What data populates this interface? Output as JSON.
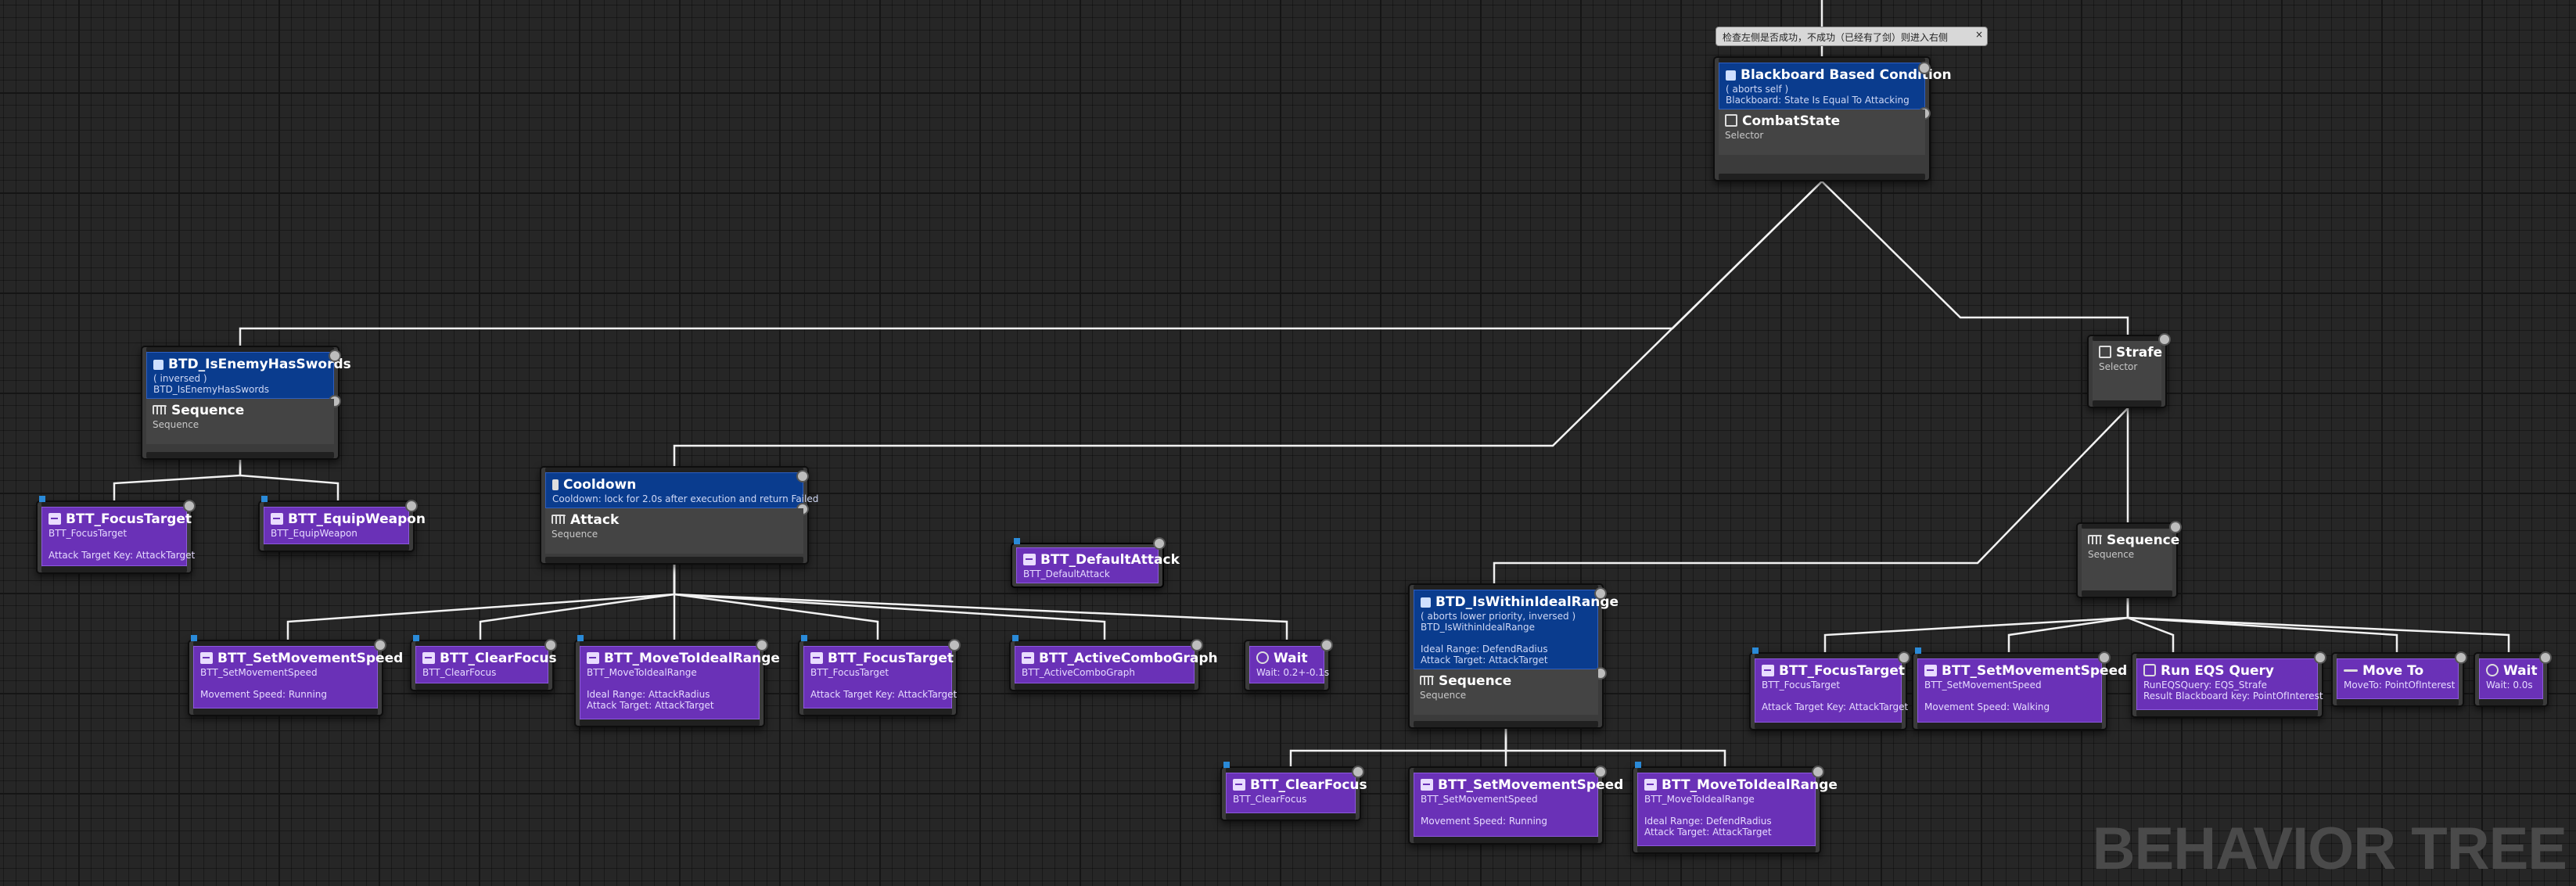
{
  "graph_label": "BEHAVIOR TREE",
  "comment": {
    "text": "检查左侧是否成功，不成功（已经有了剑）则进入右侧",
    "close_glyph": "×"
  },
  "nodes": {
    "root": {
      "decorator": {
        "title": "Blackboard Based Condition",
        "lines": [
          "( aborts self )",
          "Blackboard: State Is Equal To Attacking"
        ]
      },
      "title": "CombatState",
      "type": "Selector"
    },
    "enemy_swords": {
      "decorator": {
        "title": "BTD_IsEnemyHasSwords",
        "lines": [
          "( inversed )",
          "BTD_IsEnemyHasSwords"
        ]
      },
      "title": "Sequence",
      "type": "Sequence"
    },
    "t_focus_1": {
      "title": "BTT_FocusTarget",
      "lines": [
        "BTT_FocusTarget",
        "",
        "Attack Target Key: AttackTarget"
      ]
    },
    "t_equip": {
      "title": "BTT_EquipWeapon",
      "lines": [
        "BTT_EquipWeapon"
      ]
    },
    "attack": {
      "decorator": {
        "title": "Cooldown",
        "lines": [
          "Cooldown: lock for 2.0s after execution and return Failed"
        ]
      },
      "title": "Attack",
      "type": "Sequence"
    },
    "t_default_attack": {
      "title": "BTT_DefaultAttack",
      "lines": [
        "BTT_DefaultAttack"
      ]
    },
    "t_setspeed_1": {
      "title": "BTT_SetMovementSpeed",
      "lines": [
        "BTT_SetMovementSpeed",
        "",
        "Movement Speed: Running"
      ]
    },
    "t_clearfocus_1": {
      "title": "BTT_ClearFocus",
      "lines": [
        "BTT_ClearFocus"
      ]
    },
    "t_moveideal_1": {
      "title": "BTT_MoveToIdealRange",
      "lines": [
        "BTT_MoveToIdealRange",
        "",
        "Ideal Range: AttackRadius",
        "Attack Target: AttackTarget"
      ]
    },
    "t_focus_2": {
      "title": "BTT_FocusTarget",
      "lines": [
        "BTT_FocusTarget",
        "",
        "Attack Target Key: AttackTarget"
      ]
    },
    "t_combo": {
      "title": "BTT_ActiveComboGraph",
      "lines": [
        "BTT_ActiveComboGraph"
      ]
    },
    "t_wait_1": {
      "title": "Wait",
      "lines": [
        "Wait: 0.2+-0.1s"
      ]
    },
    "ideal_range": {
      "decorator": {
        "title": "BTD_IsWithinIdealRange",
        "lines": [
          "( aborts lower priority, inversed )",
          "BTD_IsWithinIdealRange",
          "",
          "Ideal Range: DefendRadius",
          "Attack Target: AttackTarget"
        ]
      },
      "title": "Sequence",
      "type": "Sequence"
    },
    "t_clearfocus_2": {
      "title": "BTT_ClearFocus",
      "lines": [
        "BTT_ClearFocus"
      ]
    },
    "t_setspeed_2": {
      "title": "BTT_SetMovementSpeed",
      "lines": [
        "BTT_SetMovementSpeed",
        "",
        "Movement Speed: Running"
      ]
    },
    "t_moveideal_2": {
      "title": "BTT_MoveToIdealRange",
      "lines": [
        "BTT_MoveToIdealRange",
        "",
        "Ideal Range: DefendRadius",
        "Attack Target: AttackTarget"
      ]
    },
    "strafe": {
      "title": "Strafe",
      "type": "Selector"
    },
    "strafe_seq": {
      "title": "Sequence",
      "type": "Sequence"
    },
    "t_focus_3": {
      "title": "BTT_FocusTarget",
      "lines": [
        "BTT_FocusTarget",
        "",
        "Attack Target Key: AttackTarget"
      ]
    },
    "t_setspeed_3": {
      "title": "BTT_SetMovementSpeed",
      "lines": [
        "BTT_SetMovementSpeed",
        "",
        "Movement Speed: Walking"
      ]
    },
    "t_eqs": {
      "title": "Run EQS Query",
      "lines": [
        "RunEQSQuery: EQS_Strafe",
        "Result Blackboard key: PointOfInterest"
      ]
    },
    "t_moveto": {
      "title": "Move To",
      "lines": [
        "MoveTo: PointOfInterest"
      ]
    },
    "t_wait_2": {
      "title": "Wait",
      "lines": [
        "Wait: 0.0s"
      ]
    }
  }
}
